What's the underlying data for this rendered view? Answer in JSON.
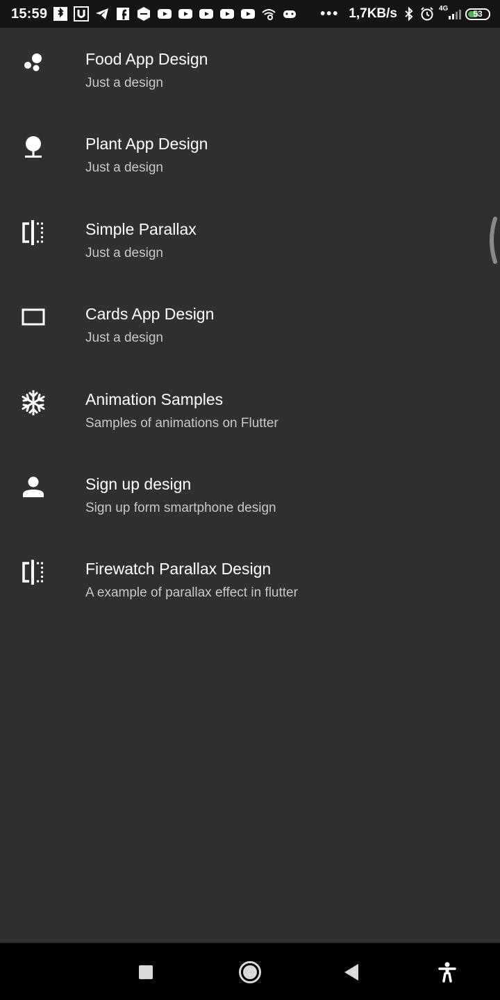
{
  "status_bar": {
    "time": "15:59",
    "network_speed": "1,7KB/s",
    "signal_label": "4G",
    "battery": "53",
    "battery_level": 0.53,
    "notification_icons": [
      "bluetooth-app-icon",
      "u-app-icon",
      "telegram-icon",
      "facebook-icon",
      "shield-app-icon",
      "youtube-icon",
      "youtube-icon",
      "youtube-icon",
      "youtube-icon",
      "youtube-icon",
      "wifi-link-icon",
      "game-controller-icon"
    ],
    "overflow": "•••"
  },
  "list": {
    "items": [
      {
        "icon": "bubbles-icon",
        "title": "Food App Design",
        "subtitle": "Just a design"
      },
      {
        "icon": "tree-icon",
        "title": "Plant App Design",
        "subtitle": "Just a design"
      },
      {
        "icon": "compare-icon",
        "title": "Simple Parallax",
        "subtitle": "Just a design"
      },
      {
        "icon": "rectangle-icon",
        "title": "Cards App Design",
        "subtitle": "Just a design"
      },
      {
        "icon": "snowflake-icon",
        "title": "Animation Samples",
        "subtitle": "Samples of animations on Flutter"
      },
      {
        "icon": "person-icon",
        "title": "Sign up design",
        "subtitle": "Sign up form smartphone design"
      },
      {
        "icon": "compare-icon",
        "title": "Firewatch Parallax Design",
        "subtitle": "A example of parallax effect in flutter"
      }
    ]
  },
  "nav_bar": {
    "buttons": [
      "recents-button",
      "home-button",
      "back-button",
      "accessibility-button"
    ]
  }
}
